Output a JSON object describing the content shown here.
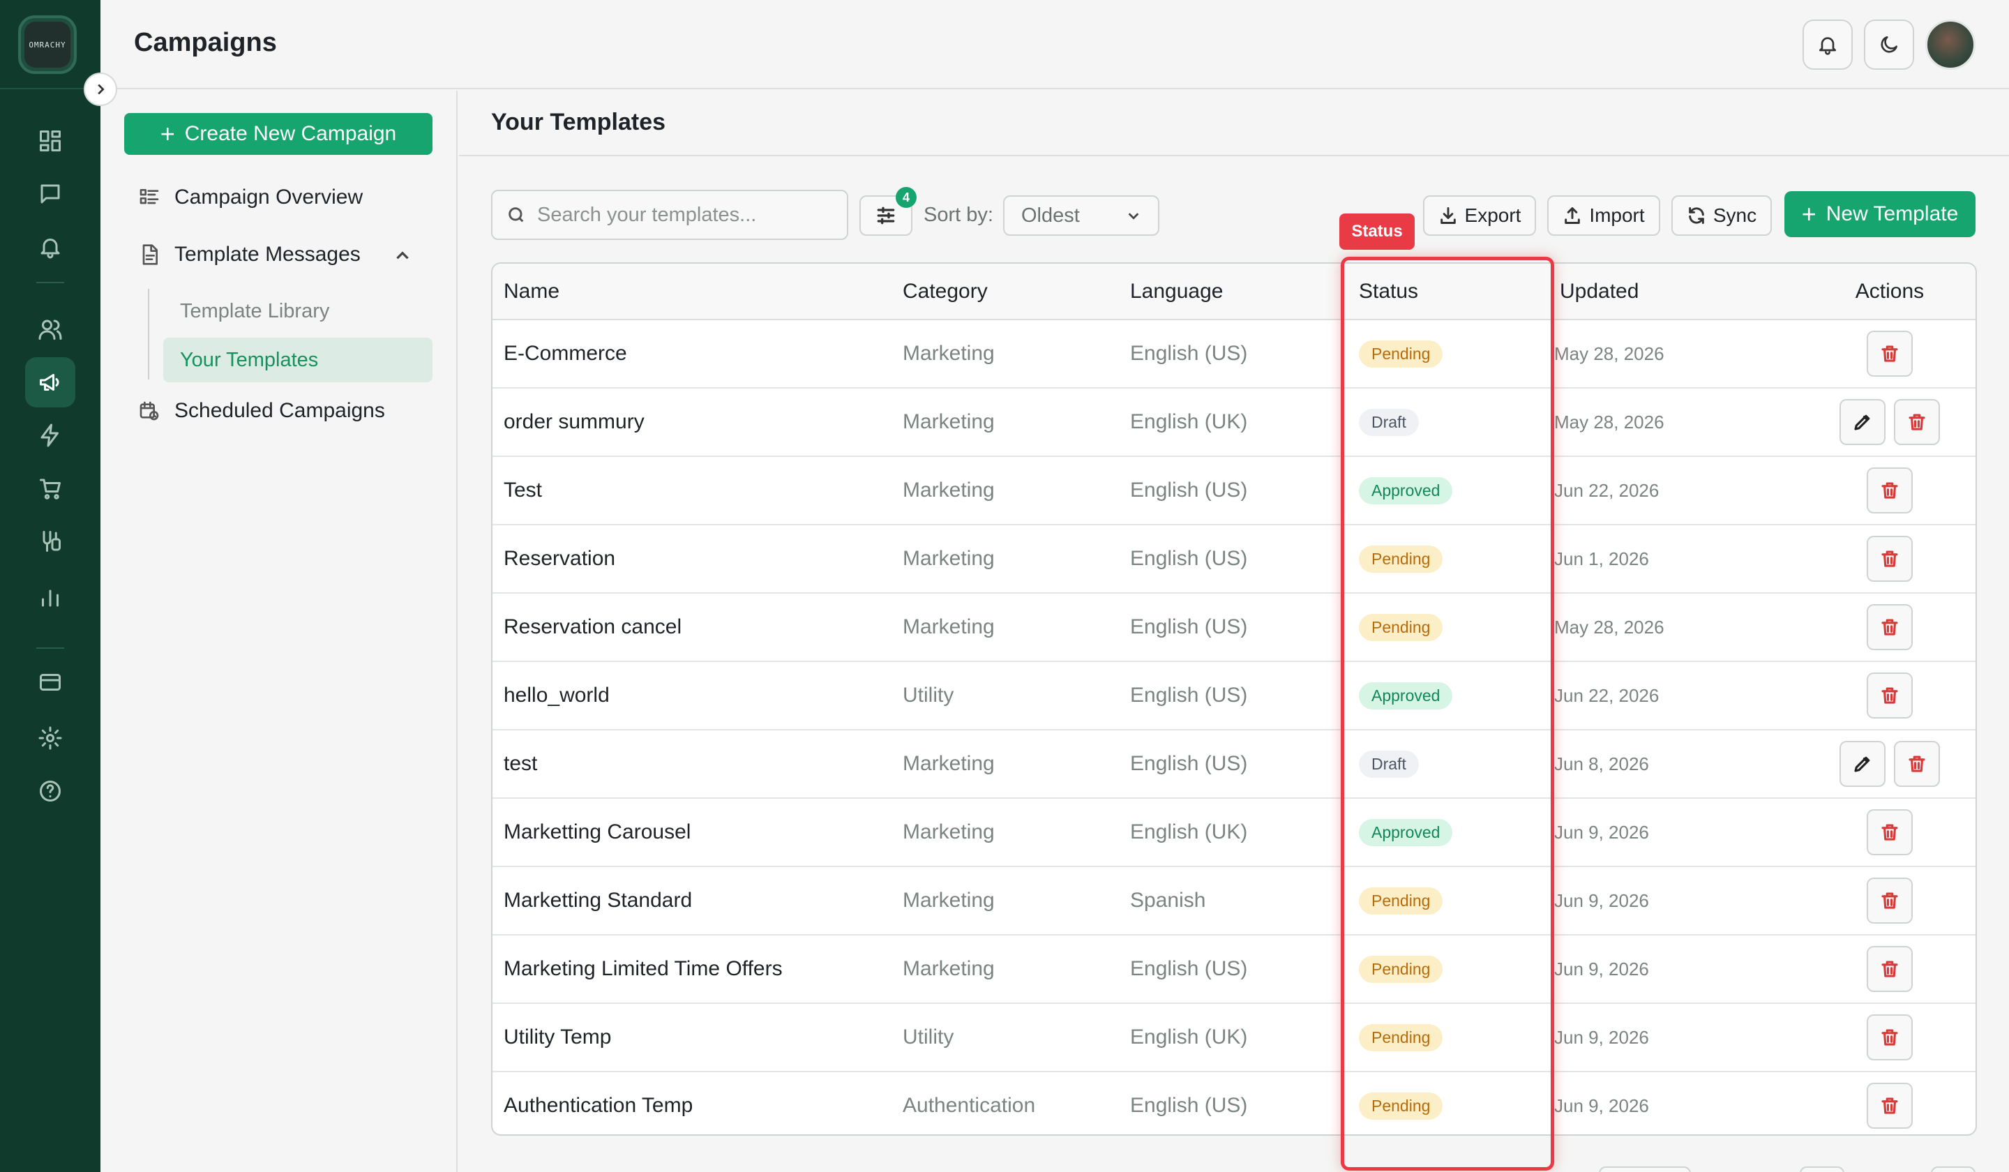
{
  "app": {
    "logo_text": "OMRACHY"
  },
  "header": {
    "title": "Campaigns"
  },
  "subnav": {
    "create_label": "Create New Campaign",
    "items": [
      {
        "label": "Campaign Overview"
      },
      {
        "label": "Template Messages"
      },
      {
        "label": "Scheduled Campaigns"
      }
    ],
    "sub_items": [
      {
        "label": "Template Library"
      },
      {
        "label": "Your Templates"
      }
    ]
  },
  "main": {
    "title": "Your Templates",
    "search_placeholder": "Search your templates...",
    "filter_count": "4",
    "sort_label": "Sort by:",
    "sort_value": "Oldest",
    "export_label": "Export",
    "import_label": "Import",
    "sync_label": "Sync",
    "new_template_label": "New Template",
    "status_annotation": "Status"
  },
  "table": {
    "headers": {
      "name": "Name",
      "category": "Category",
      "language": "Language",
      "status": "Status",
      "updated": "Updated",
      "actions": "Actions"
    },
    "rows": [
      {
        "name": "E-Commerce",
        "category": "Marketing",
        "language": "English (US)",
        "status": "Pending",
        "status_kind": "pending",
        "updated": "May 28, 2026",
        "editable": false
      },
      {
        "name": "order summury",
        "category": "Marketing",
        "language": "English (UK)",
        "status": "Draft",
        "status_kind": "draft",
        "updated": "May 28, 2026",
        "editable": true
      },
      {
        "name": "Test",
        "category": "Marketing",
        "language": "English (US)",
        "status": "Approved",
        "status_kind": "approved",
        "updated": "Jun 22, 2026",
        "editable": false
      },
      {
        "name": "Reservation",
        "category": "Marketing",
        "language": "English (US)",
        "status": "Pending",
        "status_kind": "pending",
        "updated": "Jun 1, 2026",
        "editable": false
      },
      {
        "name": "Reservation cancel",
        "category": "Marketing",
        "language": "English (US)",
        "status": "Pending",
        "status_kind": "pending",
        "updated": "May 28, 2026",
        "editable": false
      },
      {
        "name": "hello_world",
        "category": "Utility",
        "language": "English (US)",
        "status": "Approved",
        "status_kind": "approved",
        "updated": "Jun 22, 2026",
        "editable": false
      },
      {
        "name": "test",
        "category": "Marketing",
        "language": "English (US)",
        "status": "Draft",
        "status_kind": "draft",
        "updated": "Jun 8, 2026",
        "editable": true
      },
      {
        "name": "Marketting Carousel",
        "category": "Marketing",
        "language": "English (UK)",
        "status": "Approved",
        "status_kind": "approved",
        "updated": "Jun 9, 2026",
        "editable": false
      },
      {
        "name": "Marketting Standard",
        "category": "Marketing",
        "language": "Spanish",
        "status": "Pending",
        "status_kind": "pending",
        "updated": "Jun 9, 2026",
        "editable": false
      },
      {
        "name": "Marketing Limited Time Offers",
        "category": "Marketing",
        "language": "English (US)",
        "status": "Pending",
        "status_kind": "pending",
        "updated": "Jun 9, 2026",
        "editable": false
      },
      {
        "name": "Utility Temp",
        "category": "Utility",
        "language": "English (UK)",
        "status": "Pending",
        "status_kind": "pending",
        "updated": "Jun 9, 2026",
        "editable": false
      },
      {
        "name": "Authentication Temp",
        "category": "Authentication",
        "language": "English (US)",
        "status": "Pending",
        "status_kind": "pending",
        "updated": "Jun 9, 2026",
        "editable": false
      }
    ]
  },
  "colors": {
    "brand": "#16a56f",
    "rail": "#0f3a2c",
    "highlight": "#e83b45"
  }
}
